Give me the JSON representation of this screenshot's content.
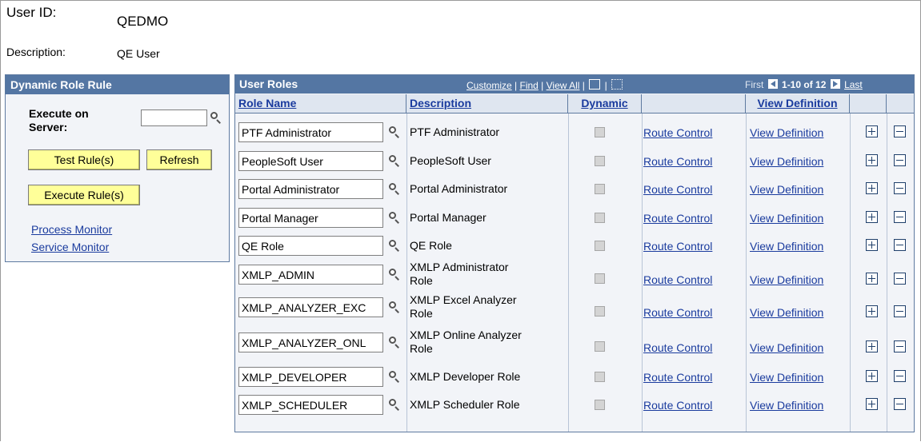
{
  "header": {
    "user_id_label": "User ID:",
    "user_id_value": "QEDMO",
    "description_label": "Description:",
    "description_value": "QE User"
  },
  "dynamic_role_rule": {
    "title": "Dynamic Role Rule",
    "execute_label": "Execute on Server:",
    "server_value": "",
    "test_button": "Test Rule(s)",
    "refresh_button": "Refresh",
    "execute_button": "Execute Rule(s)",
    "process_monitor_link": "Process Monitor",
    "service_monitor_link": "Service Monitor"
  },
  "user_roles": {
    "title": "User Roles",
    "tools": {
      "customize": "Customize",
      "find": "Find",
      "view_all": "View All"
    },
    "nav": {
      "first": "First",
      "range": "1-10 of 12",
      "last": "Last"
    },
    "columns": {
      "role_name": "Role Name",
      "description": "Description",
      "dynamic": "Dynamic",
      "view_definition": "View Definition"
    },
    "rows": [
      {
        "role": "PTF Administrator",
        "desc1": "PTF Administrator",
        "desc2": "",
        "route": "Route Control",
        "view": "View Definition"
      },
      {
        "role": "PeopleSoft User",
        "desc1": "PeopleSoft User",
        "desc2": "",
        "route": "Route Control",
        "view": "View Definition"
      },
      {
        "role": "Portal Administrator",
        "desc1": "Portal Administrator",
        "desc2": "",
        "route": "Route Control",
        "view": "View Definition"
      },
      {
        "role": "Portal Manager",
        "desc1": "Portal Manager",
        "desc2": "",
        "route": "Route Control",
        "view": "View Definition"
      },
      {
        "role": "QE Role",
        "desc1": "QE Role",
        "desc2": "",
        "route": "Route Control",
        "view": "View Definition"
      },
      {
        "role": "XMLP_ADMIN",
        "desc1": "XMLP Administrator",
        "desc2": "Role",
        "route": "Route Control",
        "view": "View Definition"
      },
      {
        "role": "XMLP_ANALYZER_EXC",
        "desc1": "XMLP Excel Analyzer",
        "desc2": "Role",
        "route": "Route Control",
        "view": "View Definition"
      },
      {
        "role": "XMLP_ANALYZER_ONL",
        "desc1": "XMLP Online Analyzer",
        "desc2": "Role",
        "route": "Route Control",
        "view": "View Definition"
      },
      {
        "role": "XMLP_DEVELOPER",
        "desc1": "XMLP Developer Role",
        "desc2": "",
        "route": "Route Control",
        "view": "View Definition"
      },
      {
        "role": "XMLP_SCHEDULER",
        "desc1": "XMLP Scheduler Role",
        "desc2": "",
        "route": "Route Control",
        "view": "View Definition"
      }
    ]
  }
}
